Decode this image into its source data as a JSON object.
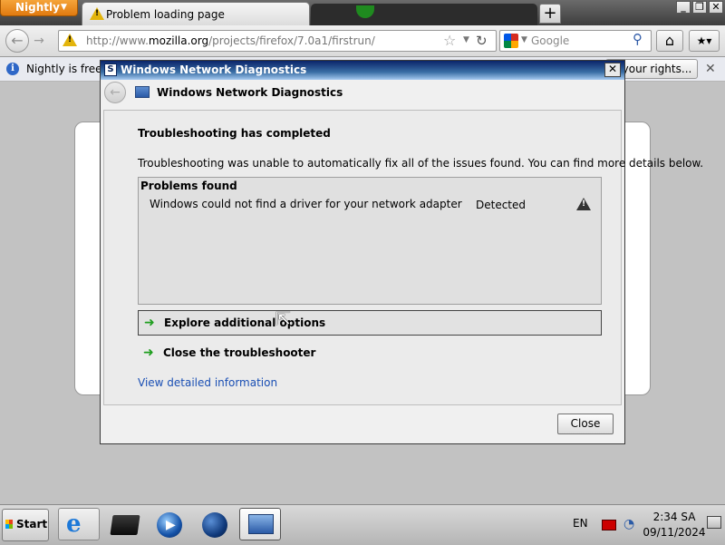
{
  "browser": {
    "app_button": "Nightly",
    "tab_title": "Problem loading page",
    "new_tab": "+",
    "url_prefix": "http://www.",
    "url_domain": "mozilla.org",
    "url_path": "/projects/firefox/7.0a1/firstrun/",
    "search_placeholder": "Google",
    "notification_text": "Nightly is free an",
    "notification_button": "w your rights...",
    "icons": [
      "back-icon",
      "forward-icon",
      "warning-icon",
      "star-icon",
      "reload-icon",
      "google-icon",
      "search-icon",
      "home-icon",
      "bookmarks-icon",
      "info-icon",
      "close-icon"
    ]
  },
  "dialog": {
    "title": "Windows Network Diagnostics",
    "header": "Windows Network Diagnostics",
    "completed": "Troubleshooting has completed",
    "description": "Troubleshooting was unable to automatically fix all of the issues found. You can find more details below.",
    "problems_heading": "Problems found",
    "problems": [
      {
        "text": "Windows could not find a driver for your network adapter",
        "status": "Detected"
      }
    ],
    "option_explore": "Explore additional options",
    "option_close": "Close the troubleshooter",
    "details_link": "View detailed information",
    "close_button": "Close"
  },
  "taskbar": {
    "start_label": "Start",
    "language": "EN",
    "time": "2:34 SA",
    "date": "09/11/2024"
  },
  "colors": {
    "dialog_title_start": "#0a246a",
    "dialog_title_end": "#a6caf0",
    "link": "#1a4fb4",
    "option_arrow": "#1e9e1e",
    "nightly_orange": "#e07a10"
  }
}
